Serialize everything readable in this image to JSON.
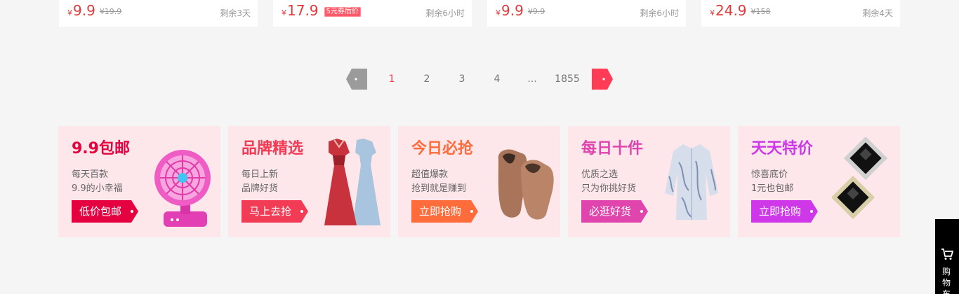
{
  "products": [
    {
      "price": "9.9",
      "old_price": "¥19.9",
      "coupon": "",
      "remain": "剩余3天"
    },
    {
      "price": "17.9",
      "old_price": "",
      "coupon": "5元券后价",
      "remain": "剩余6小时"
    },
    {
      "price": "9.9",
      "old_price": "¥9.9",
      "coupon": "",
      "remain": "剩余6小时"
    },
    {
      "price": "24.9",
      "old_price": "¥158",
      "coupon": "",
      "remain": "剩余4天"
    }
  ],
  "currency_symbol": "¥",
  "pagination": {
    "pages": [
      "1",
      "2",
      "3",
      "4",
      "...",
      "1855"
    ],
    "current": "1",
    "prev_icon": "tag-prev-icon",
    "next_icon": "tag-next-icon"
  },
  "promos": [
    {
      "title": "9.9包邮",
      "sub1": "每天百款",
      "sub2": "9.9的小幸福",
      "button": "低价包邮",
      "color": "#e5003f",
      "image": "mini-fan"
    },
    {
      "title": "品牌精选",
      "sub1": "每日上新",
      "sub2": "品牌好货",
      "button": "马上去抢",
      "color": "#f23b55",
      "image": "dresses"
    },
    {
      "title": "今日必抢",
      "sub1": "超值爆款",
      "sub2": "抢到就是赚到",
      "button": "立即抢购",
      "color": "#ff6c3c",
      "image": "loafers"
    },
    {
      "title": "每日十件",
      "sub1": "优质之选",
      "sub2": "只为你挑好货",
      "button": "必逛好货",
      "color": "#df45ad",
      "image": "shirt"
    },
    {
      "title": "天天特价",
      "sub1": "惊喜底价",
      "sub2": "1元也包邮",
      "button": "立即抢购",
      "color": "#cf38e8",
      "image": "earrings"
    }
  ],
  "side_cart": {
    "label": "购物车",
    "icon": "cart-icon"
  }
}
